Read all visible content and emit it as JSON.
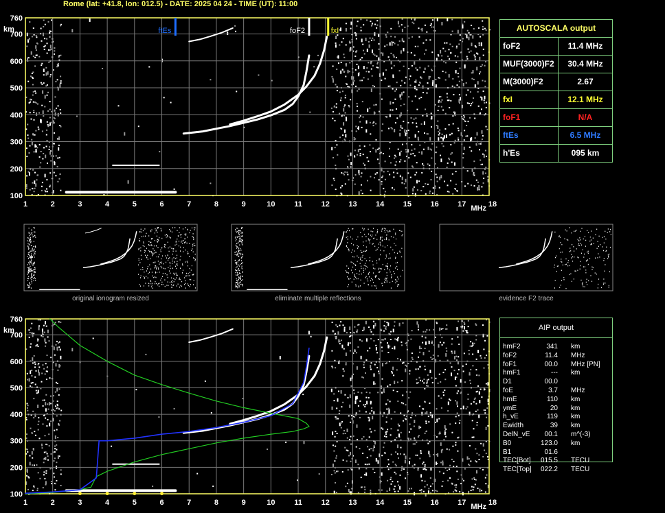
{
  "header": "Rome (lat: +41.8, lon: 012.5) - DATE: 2025 04 24 - TIME (UT): 11:00",
  "colors": {
    "axis": "#ffff66",
    "grid": "#7a7a7a",
    "trace": "#ffffff",
    "green": "#22cc22",
    "blue": "#2233ff",
    "ftEs_marker": "#1e6eff",
    "fxI_marker": "#ffff33",
    "table_border": "#7fd07f",
    "foF1_text": "#ff2222"
  },
  "chart_data": [
    {
      "type": "scatter",
      "name": "ionogram",
      "x_ticks": [
        "1",
        "2",
        "3",
        "4",
        "5",
        "6",
        "7",
        "8",
        "9",
        "10",
        "11",
        "12",
        "13",
        "14",
        "15",
        "16",
        "17",
        "18"
      ],
      "y_ticks": [
        "100",
        "200",
        "300",
        "400",
        "500",
        "600",
        "700",
        "760"
      ],
      "xlabel": "MHz",
      "ylabel": "km",
      "xlim": [
        1,
        18
      ],
      "ylim": [
        100,
        760
      ],
      "markers": [
        {
          "label": "ftEs",
          "x": 6.5,
          "color": "#1e6eff"
        },
        {
          "label": "foF2",
          "x": 11.4,
          "color": "#ffffff"
        },
        {
          "label": "fxI",
          "x": 12.1,
          "color": "#ffff33"
        }
      ],
      "traces": {
        "o_F2": [
          [
            6.8,
            330
          ],
          [
            7.5,
            338
          ],
          [
            8,
            348
          ],
          [
            8.5,
            358
          ],
          [
            9,
            370
          ],
          [
            9.5,
            382
          ],
          [
            10,
            398
          ],
          [
            10.5,
            418
          ],
          [
            10.8,
            440
          ],
          [
            11,
            468
          ],
          [
            11.2,
            510
          ],
          [
            11.3,
            560
          ],
          [
            11.4,
            620
          ]
        ],
        "x_F2": [
          [
            8.5,
            364
          ],
          [
            9,
            378
          ],
          [
            9.5,
            394
          ],
          [
            10,
            412
          ],
          [
            10.5,
            438
          ],
          [
            11,
            474
          ],
          [
            11.3,
            505
          ],
          [
            11.6,
            545
          ],
          [
            11.8,
            590
          ],
          [
            11.95,
            640
          ],
          [
            12.05,
            690
          ]
        ],
        "Es": [
          [
            2.5,
            112
          ],
          [
            3,
            112
          ],
          [
            3.5,
            112
          ],
          [
            4,
            112
          ],
          [
            4.5,
            112
          ],
          [
            5,
            112
          ],
          [
            5.5,
            112
          ],
          [
            6,
            112
          ],
          [
            6.5,
            112
          ]
        ],
        "Es_2": [
          [
            4.2,
            212
          ],
          [
            4.6,
            212
          ],
          [
            5,
            212
          ],
          [
            5.5,
            212
          ],
          [
            5.9,
            212
          ]
        ],
        "multi": [
          [
            7,
            672
          ],
          [
            7.4,
            680
          ],
          [
            7.8,
            692
          ],
          [
            8.2,
            705
          ],
          [
            8.6,
            722
          ]
        ]
      }
    },
    {
      "type": "line",
      "name": "aip_profile",
      "x_ticks": [
        "1",
        "2",
        "3",
        "4",
        "5",
        "6",
        "7",
        "8",
        "9",
        "10",
        "11",
        "12",
        "13",
        "14",
        "15",
        "16",
        "17",
        "18"
      ],
      "y_ticks": [
        "100",
        "200",
        "300",
        "400",
        "500",
        "600",
        "700",
        "760"
      ],
      "xlabel": "MHz",
      "ylabel": "km",
      "xlim": [
        1,
        18
      ],
      "ylim": [
        100,
        760
      ],
      "green_profile": [
        [
          1,
          100
        ],
        [
          2,
          105
        ],
        [
          3,
          115
        ],
        [
          3.4,
          125
        ],
        [
          3.6,
          165
        ],
        [
          4,
          185
        ],
        [
          5,
          220
        ],
        [
          6,
          248
        ],
        [
          7,
          270
        ],
        [
          8,
          292
        ],
        [
          9,
          310
        ],
        [
          10,
          325
        ],
        [
          10.8,
          335
        ],
        [
          11.2,
          345
        ],
        [
          11.4,
          354
        ],
        [
          11.3,
          366
        ],
        [
          11,
          384
        ],
        [
          10,
          404
        ],
        [
          9,
          425
        ],
        [
          8,
          450
        ],
        [
          7,
          480
        ],
        [
          6,
          512
        ],
        [
          5,
          548
        ],
        [
          4,
          600
        ],
        [
          3,
          660
        ],
        [
          2.2,
          730
        ],
        [
          1.9,
          760
        ]
      ],
      "blue_trace": [
        [
          1,
          102
        ],
        [
          2,
          107
        ],
        [
          3,
          115
        ],
        [
          3.6,
          160
        ],
        [
          3.7,
          300
        ],
        [
          4,
          300
        ],
        [
          5,
          310
        ],
        [
          6,
          325
        ],
        [
          7,
          335
        ],
        [
          8,
          350
        ],
        [
          9,
          370
        ],
        [
          10,
          395
        ],
        [
          10.8,
          440
        ],
        [
          11.2,
          520
        ],
        [
          11.3,
          580
        ],
        [
          11.4,
          650
        ]
      ],
      "green_markers_x": [
        3,
        4,
        5,
        6
      ]
    }
  ],
  "subpanels": [
    "original ionogram resized",
    "eliminate multiple reflections",
    "evidence F2 trace"
  ],
  "autoscala": {
    "title": "AUTOSCALA output",
    "rows": [
      {
        "key": "foF2",
        "value": "11.4 MHz",
        "color": "#ffffff"
      },
      {
        "key": "MUF(3000)F2",
        "value": "30.4 MHz",
        "color": "#ffffff"
      },
      {
        "key": "M(3000)F2",
        "value": "2.67",
        "color": "#ffffff"
      },
      {
        "key": "fxI",
        "value": "12.1 MHz",
        "color": "#ffff33"
      },
      {
        "key": "foF1",
        "value": "N/A",
        "color": "#ff2222"
      },
      {
        "key": "ftEs",
        "value": "6.5 MHz",
        "color": "#2e7bff"
      },
      {
        "key": "h'Es",
        "value": "095      km",
        "color": "#ffffff"
      }
    ]
  },
  "aip": {
    "title": "AIP output",
    "rows": [
      {
        "k": "hmF2",
        "v": "341",
        "u": "km"
      },
      {
        "k": "foF2",
        "v": "11.4",
        "u": "MHz"
      },
      {
        "k": "foF1",
        "v": "00.0",
        "u": "MHz  [PN]"
      },
      {
        "k": "hmF1",
        "v": "---",
        "u": "km"
      },
      {
        "k": "D1",
        "v": "00.0",
        "u": ""
      },
      {
        "k": "foE",
        "v": "3.7",
        "u": "MHz"
      },
      {
        "k": "hmE",
        "v": "110",
        "u": "km"
      },
      {
        "k": "ymE",
        "v": "20",
        "u": "km"
      },
      {
        "k": "h_vE",
        "v": "119",
        "u": "km"
      },
      {
        "k": "Ewidth",
        "v": "39",
        "u": "km"
      },
      {
        "k": "DelN_vE",
        "v": "00.1",
        "u": "m^(-3)"
      },
      {
        "k": "B0",
        "v": "123.0",
        "u": "km"
      },
      {
        "k": "B1",
        "v": "01.6",
        "u": ""
      },
      {
        "k": "TEC[Bot]",
        "v": "015.5",
        "u": "TECU"
      },
      {
        "k": "TEC[Top]",
        "v": "022.2",
        "u": "TECU"
      }
    ]
  }
}
